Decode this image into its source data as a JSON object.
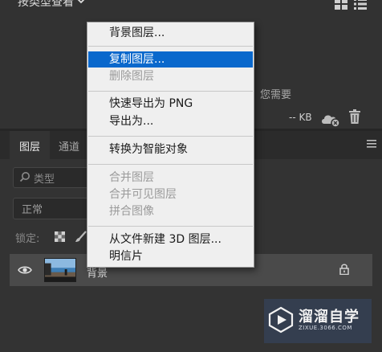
{
  "libraries": {
    "filter_label": "按类型查看",
    "hint_text": "您需要",
    "size_text": "-- KB"
  },
  "layers_panel": {
    "tabs": [
      {
        "label": "图层",
        "active": true
      },
      {
        "label": "通道",
        "active": false
      }
    ],
    "kind_placeholder": "类型",
    "blend_mode": "正常",
    "lock_label": "锁定:",
    "layer": {
      "name": "背景",
      "visible": true,
      "locked": true
    }
  },
  "context_menu": {
    "items": [
      {
        "label": "背景图层...",
        "enabled": true,
        "highlighted": false
      },
      {
        "label": "复制图层...",
        "enabled": true,
        "highlighted": true
      },
      {
        "label": "删除图层",
        "enabled": false,
        "highlighted": false
      },
      {
        "label": "快速导出为 PNG",
        "enabled": true,
        "highlighted": false
      },
      {
        "label": "导出为...",
        "enabled": true,
        "highlighted": false
      },
      {
        "label": "转换为智能对象",
        "enabled": true,
        "highlighted": false
      },
      {
        "label": "合并图层",
        "enabled": false,
        "highlighted": false
      },
      {
        "label": "合并可见图层",
        "enabled": false,
        "highlighted": false
      },
      {
        "label": "拼合图像",
        "enabled": false,
        "highlighted": false
      },
      {
        "label": "从文件新建 3D 图层...",
        "enabled": true,
        "highlighted": false
      },
      {
        "label": "明信片",
        "enabled": true,
        "highlighted": false
      }
    ]
  },
  "watermark": {
    "title": "溜溜自学",
    "url": "ZIXUE.3066.COM"
  },
  "colors": {
    "panel_bg": "#333333",
    "menu_bg": "#efefef",
    "menu_highlight": "#0a68cc",
    "selected_layer_bg": "#4a4a4a"
  },
  "icons": [
    "chevron-down-icon",
    "grid-view-icon",
    "list-view-icon",
    "cloud-offline-icon",
    "trash-icon",
    "panel-menu-icon",
    "search-icon",
    "lock-transparent-icon",
    "brush-icon",
    "eye-icon",
    "lock-icon",
    "play-logo-icon"
  ]
}
